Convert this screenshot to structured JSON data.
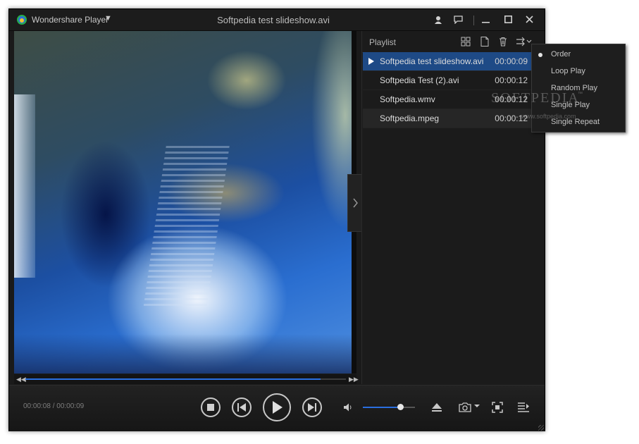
{
  "app": {
    "name": "Wondershare Player",
    "window_title": "Softpedia test slideshow.avi"
  },
  "titlebar": {
    "icons": [
      "user-icon",
      "feedback-icon",
      "minimize-icon",
      "maximize-icon",
      "close-icon"
    ]
  },
  "playback": {
    "time_display": "00:00:08 / 00:00:09",
    "progress": 0.92,
    "volume": 0.72
  },
  "playlist": {
    "title": "Playlist",
    "items": [
      {
        "name": "Softpedia test slideshow.avi",
        "duration": "00:00:09",
        "playing": true
      },
      {
        "name": "Softpedia Test (2).avi",
        "duration": "00:00:12",
        "playing": false
      },
      {
        "name": "Softpedia.wmv",
        "duration": "00:00:12",
        "playing": false
      },
      {
        "name": "Softpedia.mpeg",
        "duration": "00:00:12",
        "playing": false
      }
    ]
  },
  "order_menu": {
    "items": [
      "Order",
      "Loop Play",
      "Random Play",
      "Single Play",
      "Single Repeat"
    ],
    "selected": "Order"
  },
  "watermark": {
    "brand": "SOFTPEDIA",
    "tm": "™",
    "url": "www.softpedia.com"
  },
  "colors": {
    "accent": "#2a6fe0",
    "selected_row": "#1e4a86",
    "background": "#1a1a1a"
  }
}
